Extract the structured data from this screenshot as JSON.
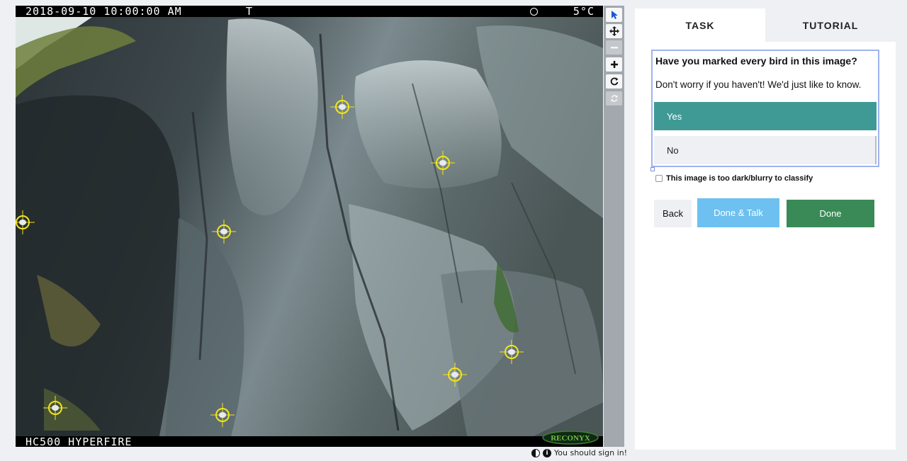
{
  "camera": {
    "datetime": "2018-09-10 10:00:00 AM",
    "flag": "T",
    "temperature": "5°C",
    "model": "HC500 HYPERFIRE",
    "brand": "RECONYX"
  },
  "tools": [
    "pointer-icon",
    "move-icon",
    "zoom-out-icon",
    "zoom-in-icon",
    "rotate-icon",
    "reset-icon"
  ],
  "status": {
    "signin_text": "You should sign in!"
  },
  "tabs": [
    {
      "label": "TASK"
    },
    {
      "label": "TUTORIAL"
    }
  ],
  "task": {
    "question": "Have you marked every bird in this image?",
    "help": "Don't worry if you haven't! We'd just like to know.",
    "answers": [
      {
        "label": "Yes",
        "selected": true
      },
      {
        "label": "No",
        "selected": false
      }
    ],
    "dark_checkbox_label": "This image is too dark/blurry to classify"
  },
  "buttons": {
    "back": "Back",
    "done_talk": "Done & Talk",
    "done": "Done"
  },
  "colors": {
    "selected_answer": "#3f9a96",
    "done_talk": "#6dc0f0",
    "done": "#3a8a57",
    "marker": "#f3e51b"
  }
}
